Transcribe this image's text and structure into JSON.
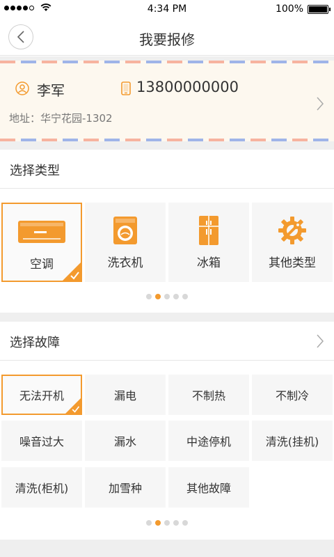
{
  "status": {
    "time": "4:34 PM",
    "battery": "100%"
  },
  "nav": {
    "title": "我要报修"
  },
  "address": {
    "name": "李军",
    "phone": "13800000000",
    "address": "地址：华宁花园-1302"
  },
  "type_section": {
    "title": "选择类型",
    "items": [
      {
        "label": "空调",
        "icon": "air-conditioner-icon",
        "selected": true
      },
      {
        "label": "洗衣机",
        "icon": "washing-machine-icon",
        "selected": false
      },
      {
        "label": "冰箱",
        "icon": "refrigerator-icon",
        "selected": false
      },
      {
        "label": "其他类型",
        "icon": "gear-wrench-icon",
        "selected": false
      }
    ],
    "pager": {
      "count": 5,
      "active": 2
    }
  },
  "fault_section": {
    "title": "选择故障",
    "items": [
      {
        "label": "无法开机",
        "selected": true
      },
      {
        "label": "漏电",
        "selected": false
      },
      {
        "label": "不制热",
        "selected": false
      },
      {
        "label": "不制冷",
        "selected": false
      },
      {
        "label": "噪音过大",
        "selected": false
      },
      {
        "label": "漏水",
        "selected": false
      },
      {
        "label": "中途停机",
        "selected": false
      },
      {
        "label": "清洗(挂机)",
        "selected": false
      },
      {
        "label": "清洗(柜机)",
        "selected": false
      },
      {
        "label": "加雪种",
        "selected": false
      },
      {
        "label": "其他故障",
        "selected": false
      }
    ],
    "pager": {
      "count": 5,
      "active": 2
    }
  },
  "colors": {
    "accent": "#f39a2e",
    "card_bg": "#fdf8ef",
    "tile_bg": "#f6f6f6",
    "divider": "#efefef"
  }
}
